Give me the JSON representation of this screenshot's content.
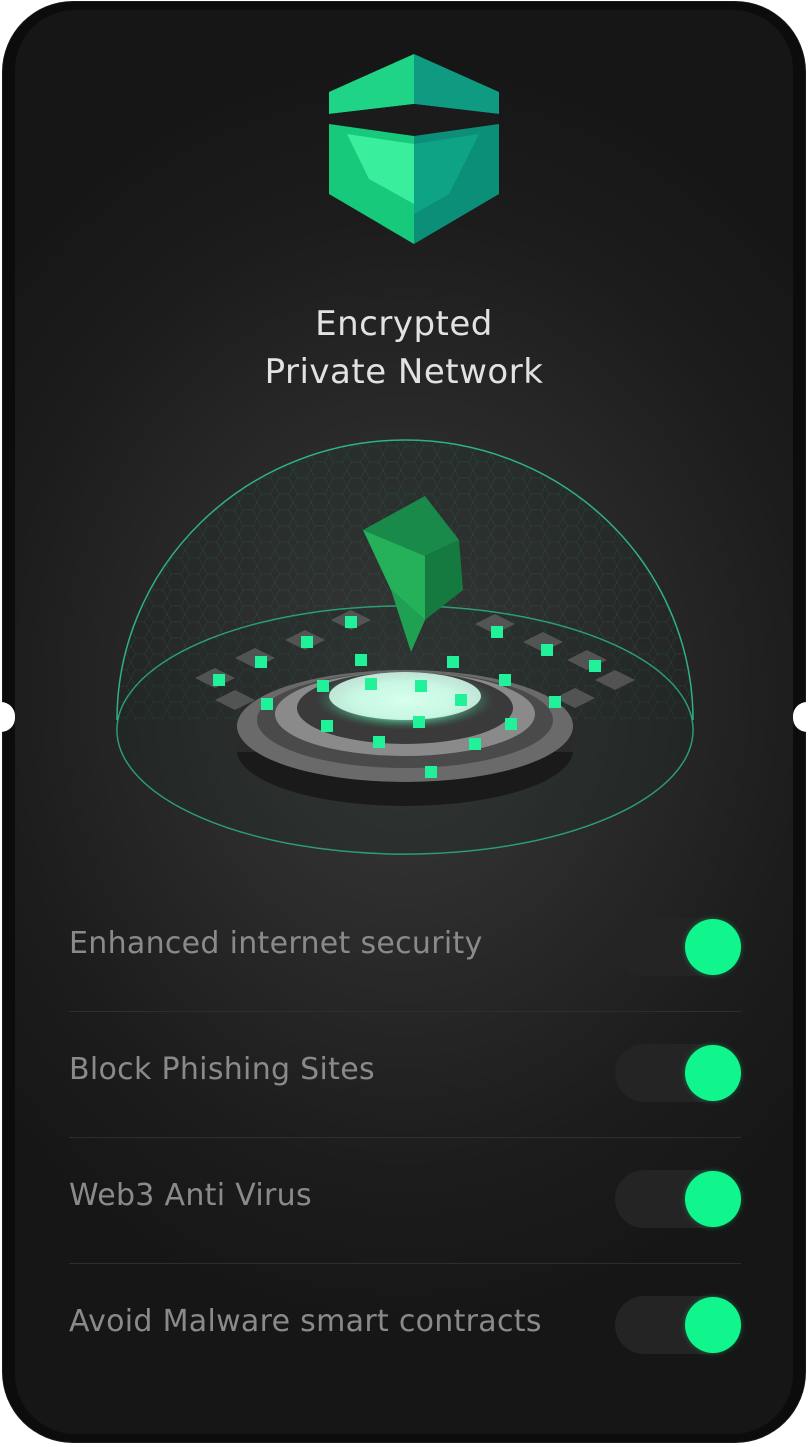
{
  "header": {
    "title_line1": "Encrypted",
    "title_line2": "Private Network"
  },
  "colors": {
    "accent": "#10f58c",
    "background": "#1c1c1c",
    "label_text": "#8a8a8a",
    "title_text": "#e2e2e2"
  },
  "icons": {
    "logo": "green-cube-logo-icon",
    "hero": "shield-dome-network-icon",
    "toggle": "toggle-switch"
  },
  "settings": [
    {
      "label": "Enhanced internet security",
      "enabled": true
    },
    {
      "label": "Block Phishing Sites",
      "enabled": true
    },
    {
      "label": "Web3 Anti Virus",
      "enabled": true
    },
    {
      "label": "Avoid Malware smart contracts",
      "enabled": true
    }
  ]
}
